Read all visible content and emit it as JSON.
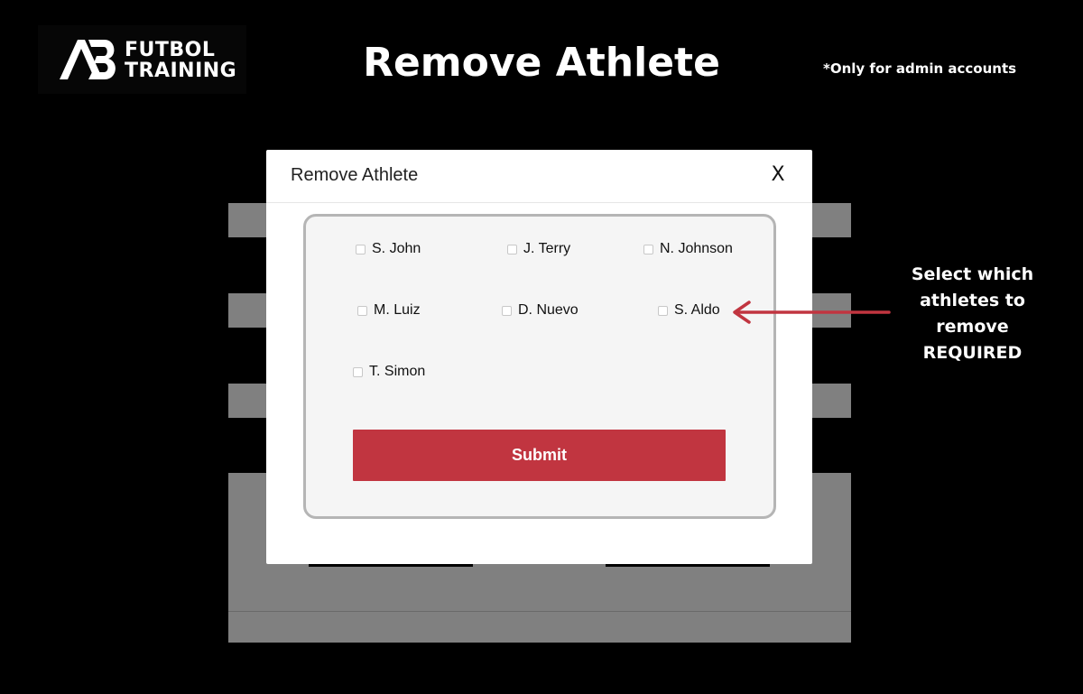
{
  "header": {
    "logo_mark": "AB",
    "logo_line1": "FUTBOL",
    "logo_line2": "TRAINING",
    "title": "Remove Athlete",
    "admin_note": "*Only for admin accounts"
  },
  "modal": {
    "title": "Remove Athlete",
    "close_label": "X",
    "athletes": [
      {
        "name": "S. John",
        "checked": false
      },
      {
        "name": "J. Terry",
        "checked": false
      },
      {
        "name": "N. Johnson",
        "checked": false
      },
      {
        "name": "M. Luiz",
        "checked": false
      },
      {
        "name": "D. Nuevo",
        "checked": false
      },
      {
        "name": "S. Aldo",
        "checked": false
      },
      {
        "name": "T. Simon",
        "checked": false
      }
    ],
    "submit_label": "Submit"
  },
  "callout": {
    "line1": "Select which",
    "line2": "athletes to",
    "line3": "remove",
    "line4": "REQUIRED"
  },
  "colors": {
    "background": "#000000",
    "accent": "#c13540",
    "panel_bg": "#f5f5f5",
    "panel_border": "#b5b5b5",
    "overlay_gray": "#808080"
  }
}
